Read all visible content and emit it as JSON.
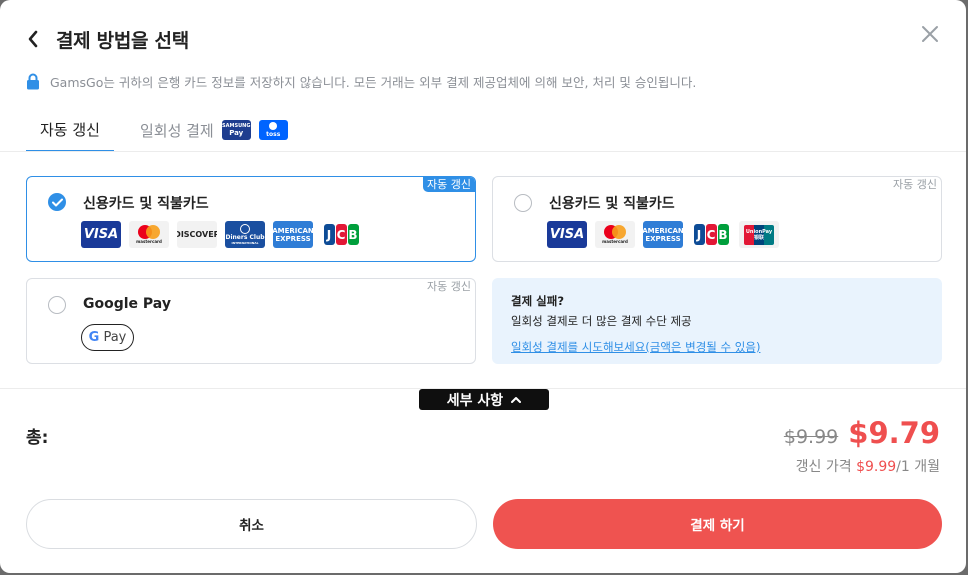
{
  "header": {
    "title": "결제 방법을 선택"
  },
  "notice": {
    "text": "GamsGo는 귀하의 은행 카드 정보를 저장하지 않습니다. 모든 거래는 외부 결제 제공업체에 의해 보안, 처리 및 승인됩니다."
  },
  "tabs": [
    {
      "label": "자동 갱신"
    },
    {
      "label": "일회성 결제"
    }
  ],
  "tab_badges": {
    "samsung_top": "SAMSUNG",
    "samsung_bottom": "Pay",
    "toss": "toss"
  },
  "options": {
    "auto_card": {
      "label": "신용카드 및 직불카드",
      "tag": "자동 갱신"
    },
    "gpay": {
      "label": "Google Pay",
      "tag": "자동 갱신",
      "button_g": "G",
      "button_pay": "Pay"
    },
    "once_card": {
      "label": "신용카드 및 직불카드",
      "tag": "자동 갱신"
    }
  },
  "logos": {
    "visa": "VISA",
    "mastercard": "mastercard",
    "discover": "DISCOVER",
    "diners_top": "Diners Club",
    "diners_bottom": "INTERNATIONAL",
    "amex_top": "AMERICAN",
    "amex_bottom": "EXPRESS",
    "jcb_j": "J",
    "jcb_c": "C",
    "jcb_b": "B",
    "unionpay_top": "UnionPay",
    "unionpay_bottom": "银联"
  },
  "fail_box": {
    "title": "결제 실패?",
    "text": "일회성 결제로 더 많은 결제 수단 제공",
    "link": "일회성 결제를 시도해보세요(금액은 변경될 수 있음)"
  },
  "details_toggle": {
    "label": "세부 사항"
  },
  "total": {
    "label": "총:",
    "original_price": "$9.99",
    "price": "$9.79",
    "renew_prefix": "갱신 가격 ",
    "renew_price": "$9.99",
    "renew_suffix": "/1 개월"
  },
  "buttons": {
    "cancel": "취소",
    "pay": "결제 하기"
  },
  "colors": {
    "accent": "#2f8fe6",
    "pay": "#ef5350",
    "price": "#ef4f4f"
  }
}
